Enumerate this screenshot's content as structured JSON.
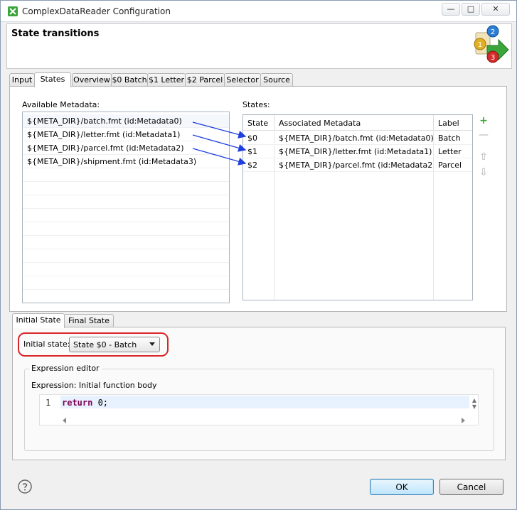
{
  "window": {
    "title": "ComplexDataReader Configuration"
  },
  "header": {
    "title": "State transitions"
  },
  "tabs": [
    "Input",
    "States",
    "Overview",
    "$0 Batch",
    "$1 Letter",
    "$2 Parcel",
    "Selector",
    "Source"
  ],
  "active_tab": "States",
  "available_metadata": {
    "label": "Available Metadata:",
    "items": [
      "${META_DIR}/batch.fmt (id:Metadata0)",
      "${META_DIR}/letter.fmt (id:Metadata1)",
      "${META_DIR}/parcel.fmt (id:Metadata2)",
      "${META_DIR}/shipment.fmt (id:Metadata3)"
    ]
  },
  "states": {
    "label": "States:",
    "columns": [
      "State",
      "Associated Metadata",
      "Label"
    ],
    "rows": [
      {
        "state": "$0",
        "metadata": "${META_DIR}/batch.fmt (id:Metadata0)",
        "label": "Batch"
      },
      {
        "state": "$1",
        "metadata": "${META_DIR}/letter.fmt (id:Metadata1)",
        "label": "Letter"
      },
      {
        "state": "$2",
        "metadata": "${META_DIR}/parcel.fmt (id:Metadata2)",
        "label": "Parcel"
      }
    ]
  },
  "lower_tabs": [
    "Initial State",
    "Final State"
  ],
  "initial_state": {
    "label": "Initial state:",
    "selected": "State $0 - Batch"
  },
  "expression_editor": {
    "group_title": "Expression editor",
    "label": "Expression: Initial function body",
    "line_number": "1",
    "code_keyword": "return",
    "code_rest": " 0;"
  },
  "buttons": {
    "ok": "OK",
    "cancel": "Cancel"
  },
  "colors": {
    "arrow": "#1f3fe0",
    "highlight": "#d9252a",
    "accent_green": "#3aa53a"
  }
}
